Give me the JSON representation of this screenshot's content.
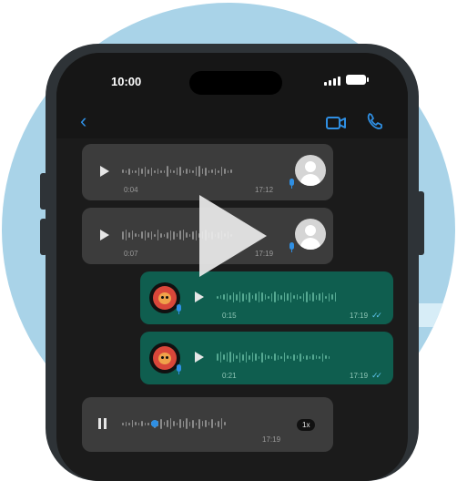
{
  "status_bar": {
    "time": "10:00"
  },
  "messages": [
    {
      "direction": "incoming",
      "duration": "0:04",
      "timestamp": "17:12"
    },
    {
      "direction": "incoming",
      "duration": "0:07",
      "timestamp": "17:19"
    },
    {
      "direction": "outgoing",
      "duration": "0:15",
      "timestamp": "17:19",
      "read": true
    },
    {
      "direction": "outgoing",
      "duration": "0:21",
      "timestamp": "17:19",
      "read": true
    },
    {
      "direction": "incoming",
      "state": "playing",
      "timestamp": "17:19",
      "speed": "1x"
    }
  ],
  "ticks_glyph": "✓✓",
  "colors": {
    "background_circle": "#a9d3e8",
    "chat_background": "#1b1b1b",
    "incoming_bubble": "#3c3c3c",
    "outgoing_bubble": "#0f5e4f",
    "accent": "#2f8fe3"
  },
  "icons": [
    "back-chevron-icon",
    "video-call-icon",
    "phone-call-icon",
    "play-icon",
    "pause-icon",
    "microphone-icon",
    "avatar-placeholder-icon",
    "lion-avatar-icon",
    "video-play-overlay-icon"
  ]
}
